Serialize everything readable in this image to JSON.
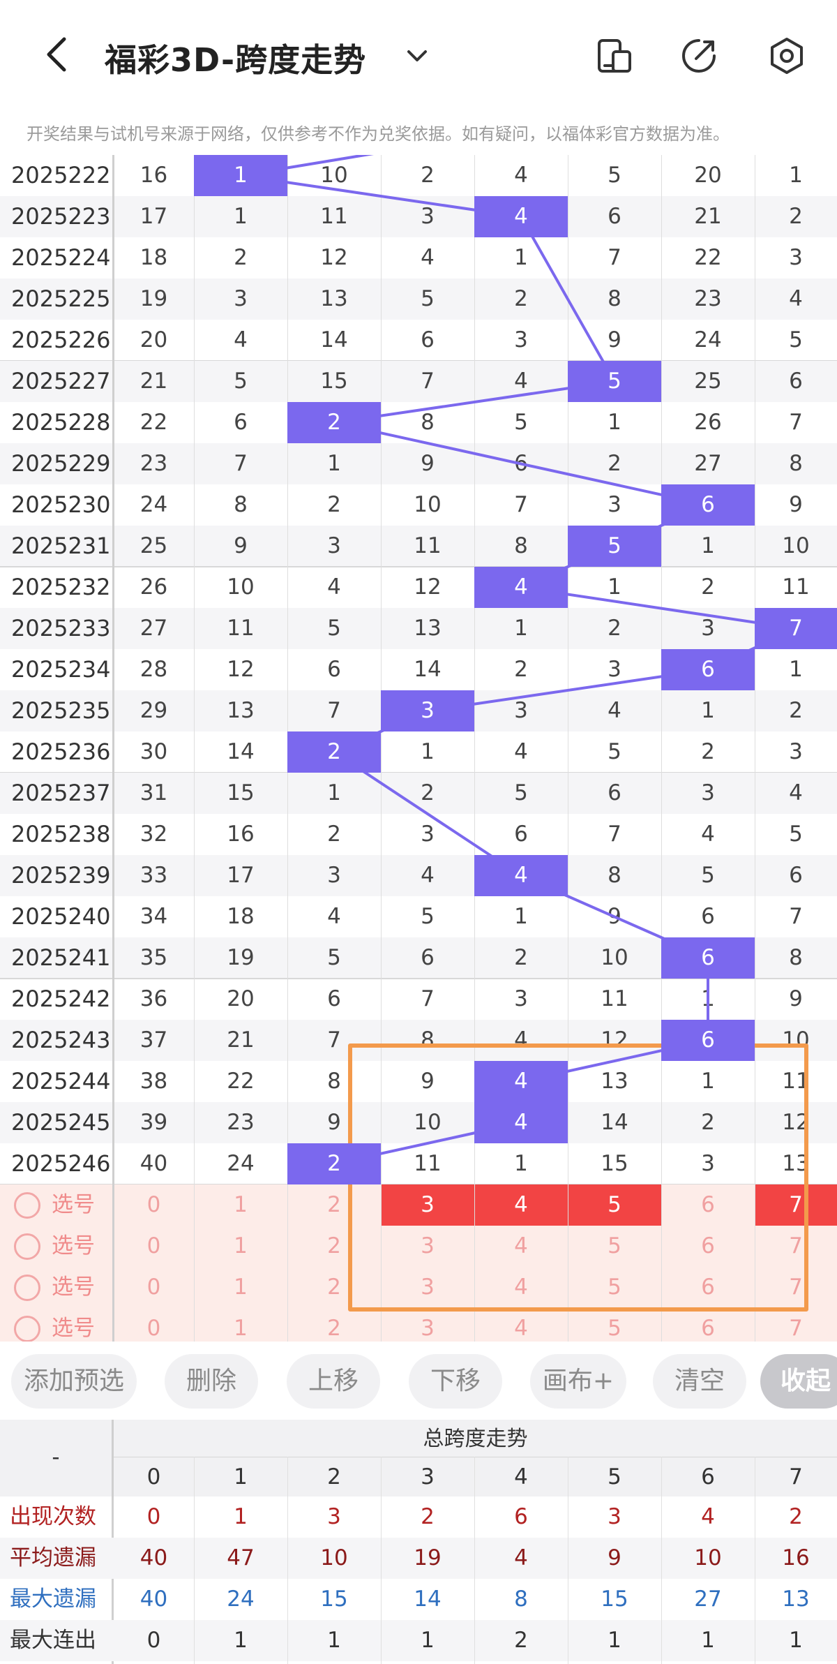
{
  "header": {
    "title": "福彩3D-跨度走势",
    "notice": "开奖结果与试机号来源于网络，仅供参考不作为兑奖依据。如有疑问，以福体彩官方数据为准。"
  },
  "icons": [
    "back-arrow-icon",
    "chevron-down-icon",
    "phone-layout-icon",
    "share-icon",
    "settings-hexagon-icon"
  ],
  "colors": {
    "hit": "#7b68ee",
    "selected": "#f24444",
    "highlight_box": "#f39a4c",
    "pick_row_bg": "#fdece8"
  },
  "columns": [
    "0",
    "1",
    "2",
    "3",
    "4",
    "5",
    "6",
    "7"
  ],
  "rows": [
    {
      "issue": "2025222",
      "values": [
        "16",
        "1",
        "10",
        "2",
        "4",
        "5",
        "20",
        "1"
      ],
      "span": 1
    },
    {
      "issue": "2025223",
      "values": [
        "17",
        "1",
        "11",
        "3",
        "4",
        "6",
        "21",
        "2"
      ],
      "span": 4
    },
    {
      "issue": "2025224",
      "values": [
        "18",
        "2",
        "12",
        "4",
        "1",
        "7",
        "22",
        "3"
      ],
      "span": null
    },
    {
      "issue": "2025225",
      "values": [
        "19",
        "3",
        "13",
        "5",
        "2",
        "8",
        "23",
        "4"
      ],
      "span": null
    },
    {
      "issue": "2025226",
      "values": [
        "20",
        "4",
        "14",
        "6",
        "3",
        "9",
        "24",
        "5"
      ],
      "span": null
    },
    {
      "issue": "2025227",
      "values": [
        "21",
        "5",
        "15",
        "7",
        "4",
        "5",
        "25",
        "6"
      ],
      "span": 5
    },
    {
      "issue": "2025228",
      "values": [
        "22",
        "6",
        "2",
        "8",
        "5",
        "1",
        "26",
        "7"
      ],
      "span": 2
    },
    {
      "issue": "2025229",
      "values": [
        "23",
        "7",
        "1",
        "9",
        "6",
        "2",
        "27",
        "8"
      ],
      "span": null
    },
    {
      "issue": "2025230",
      "values": [
        "24",
        "8",
        "2",
        "10",
        "7",
        "3",
        "6",
        "9"
      ],
      "span": 6
    },
    {
      "issue": "2025231",
      "values": [
        "25",
        "9",
        "3",
        "11",
        "8",
        "5",
        "1",
        "10"
      ],
      "span": 5
    },
    {
      "issue": "2025232",
      "values": [
        "26",
        "10",
        "4",
        "12",
        "4",
        "1",
        "2",
        "11"
      ],
      "span": 4
    },
    {
      "issue": "2025233",
      "values": [
        "27",
        "11",
        "5",
        "13",
        "1",
        "2",
        "3",
        "7"
      ],
      "span": 7
    },
    {
      "issue": "2025234",
      "values": [
        "28",
        "12",
        "6",
        "14",
        "2",
        "3",
        "6",
        "1"
      ],
      "span": 6
    },
    {
      "issue": "2025235",
      "values": [
        "29",
        "13",
        "7",
        "3",
        "3",
        "4",
        "1",
        "2"
      ],
      "span": 3
    },
    {
      "issue": "2025236",
      "values": [
        "30",
        "14",
        "2",
        "1",
        "4",
        "5",
        "2",
        "3"
      ],
      "span": 2
    },
    {
      "issue": "2025237",
      "values": [
        "31",
        "15",
        "1",
        "2",
        "5",
        "6",
        "3",
        "4"
      ],
      "span": null
    },
    {
      "issue": "2025238",
      "values": [
        "32",
        "16",
        "2",
        "3",
        "6",
        "7",
        "4",
        "5"
      ],
      "span": null
    },
    {
      "issue": "2025239",
      "values": [
        "33",
        "17",
        "3",
        "4",
        "4",
        "8",
        "5",
        "6"
      ],
      "span": 4
    },
    {
      "issue": "2025240",
      "values": [
        "34",
        "18",
        "4",
        "5",
        "1",
        "9",
        "6",
        "7"
      ],
      "span": null
    },
    {
      "issue": "2025241",
      "values": [
        "35",
        "19",
        "5",
        "6",
        "2",
        "10",
        "6",
        "8"
      ],
      "span": 6
    },
    {
      "issue": "2025242",
      "values": [
        "36",
        "20",
        "6",
        "7",
        "3",
        "11",
        "1",
        "9"
      ],
      "span": null
    },
    {
      "issue": "2025243",
      "values": [
        "37",
        "21",
        "7",
        "8",
        "4",
        "12",
        "6",
        "10"
      ],
      "span": 6
    },
    {
      "issue": "2025244",
      "values": [
        "38",
        "22",
        "8",
        "9",
        "4",
        "13",
        "1",
        "11"
      ],
      "span": 4
    },
    {
      "issue": "2025245",
      "values": [
        "39",
        "23",
        "9",
        "10",
        "4",
        "14",
        "2",
        "12"
      ],
      "span": 4
    },
    {
      "issue": "2025246",
      "values": [
        "40",
        "24",
        "2",
        "11",
        "1",
        "15",
        "3",
        "13"
      ],
      "span": 2
    }
  ],
  "pick_rows": [
    {
      "label": "选号",
      "selected": [
        "3",
        "4",
        "5",
        "7"
      ]
    },
    {
      "label": "选号",
      "selected": []
    },
    {
      "label": "选号",
      "selected": []
    },
    {
      "label": "选号",
      "selected": []
    }
  ],
  "buttons": {
    "add": "添加预选",
    "delete": "删除",
    "up": "上移",
    "down": "下移",
    "canvas": "画布+",
    "clear": "清空",
    "collapse": "收起"
  },
  "stats": {
    "corner": "-",
    "group_title": "总跨度走势",
    "rows": [
      {
        "label": "出现次数",
        "color": "#b22222",
        "values": [
          "0",
          "1",
          "3",
          "2",
          "6",
          "3",
          "4",
          "2"
        ]
      },
      {
        "label": "平均遗漏",
        "color": "#8b1a1a",
        "values": [
          "40",
          "47",
          "10",
          "19",
          "4",
          "9",
          "10",
          "16"
        ]
      },
      {
        "label": "最大遗漏",
        "color": "#2f6fbf",
        "values": [
          "40",
          "24",
          "15",
          "14",
          "8",
          "15",
          "27",
          "13"
        ]
      },
      {
        "label": "最大连出",
        "color": "#333333",
        "values": [
          "0",
          "1",
          "1",
          "1",
          "2",
          "1",
          "1",
          "1"
        ]
      }
    ]
  }
}
